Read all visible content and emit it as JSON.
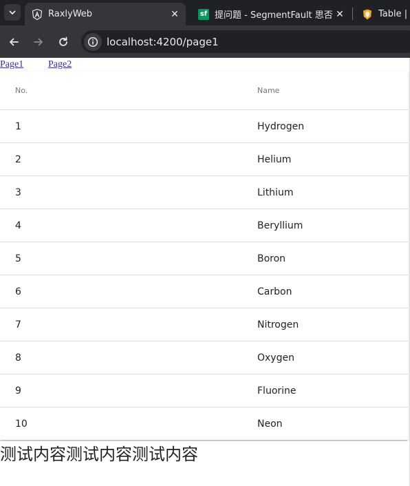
{
  "browser": {
    "tabs": [
      {
        "title": "RaxlyWeb",
        "favicon": "angular-logo-icon",
        "active": true
      },
      {
        "title": "提问题 - SegmentFault 思否",
        "favicon": "segmentfault-logo-icon",
        "favicon_text": "sf",
        "active": false
      },
      {
        "title": "Table | A",
        "favicon": "shield-logo-icon",
        "active": false
      }
    ],
    "close_glyph": "✕",
    "url": "localhost:4200/page1"
  },
  "page": {
    "links": [
      "Page1",
      "Page2"
    ],
    "table": {
      "headers": {
        "no": "No.",
        "name": "Name"
      },
      "rows": [
        {
          "no": "1",
          "name": "Hydrogen"
        },
        {
          "no": "2",
          "name": "Helium"
        },
        {
          "no": "3",
          "name": "Lithium"
        },
        {
          "no": "4",
          "name": "Beryllium"
        },
        {
          "no": "5",
          "name": "Boron"
        },
        {
          "no": "6",
          "name": "Carbon"
        },
        {
          "no": "7",
          "name": "Nitrogen"
        },
        {
          "no": "8",
          "name": "Oxygen"
        },
        {
          "no": "9",
          "name": "Fluorine"
        },
        {
          "no": "10",
          "name": "Neon"
        }
      ]
    },
    "footer_text": "测试内容测试内容测试内容"
  },
  "colors": {
    "chrome_dark": "#202124",
    "chrome_toolbar": "#35363a",
    "link": "#3f2d99",
    "sf_green": "#009a61",
    "shield_orange": "#f5a623"
  }
}
